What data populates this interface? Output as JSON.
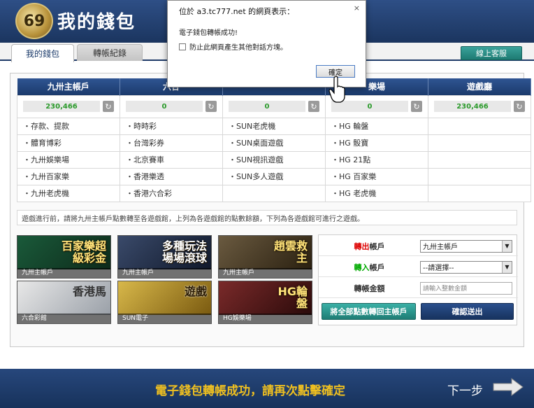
{
  "header": {
    "title": "我的錢包",
    "logo_text": "69"
  },
  "tabs": [
    {
      "label": "我的錢包",
      "active": true
    },
    {
      "label": "轉帳紀錄",
      "active": false
    }
  ],
  "support_button": "線上客服",
  "accounts": {
    "headers": [
      "九卅主帳戶",
      "六合",
      "",
      "樂場",
      "遊戲廳"
    ],
    "balances": [
      "230,466",
      "0",
      "0",
      "0",
      "230,466"
    ],
    "rows": [
      [
        "・存款、提款",
        "・時時彩",
        "・SUN老虎機",
        "・HG 輪盤",
        ""
      ],
      [
        "・體育博彩",
        "・台灣彩券",
        "・SUN桌面遊戲",
        "・HG 骰寶",
        ""
      ],
      [
        "・九卅娛樂場",
        "・北京賽車",
        "・SUN視訊遊戲",
        "・HG 21點",
        ""
      ],
      [
        "・九卅百家樂",
        "・香港樂透",
        "・SUN多人遊戲",
        "・HG 百家樂",
        ""
      ],
      [
        "・九卅老虎機",
        "・香港六合彩",
        "",
        "・HG 老虎機",
        ""
      ]
    ]
  },
  "notice": "遊戲進行前，請將九卅主帳戶點數轉至各遊戲館，上列為各遊戲館的點數餘額，下列為各遊戲館可進行之遊戲。",
  "games": [
    {
      "label": "九卅主帳戶",
      "title": "百家樂超級彩金"
    },
    {
      "label": "九卅主帳戶",
      "title": "多種玩法場場滾球"
    },
    {
      "label": "九卅主帳戶",
      "title": "趙雲救主"
    },
    {
      "label": "六合彩館",
      "title": "香港馬"
    },
    {
      "label": "SUN電子",
      "title": "遊戲"
    },
    {
      "label": "HG娛樂場",
      "title": "HG輪盤"
    }
  ],
  "transfer": {
    "from_label_red": "轉出",
    "from_label_rest": "帳戶",
    "from_value": "九卅主帳戶",
    "to_label_green": "轉入",
    "to_label_rest": "帳戶",
    "to_value": "--請選擇--",
    "amount_label": "轉帳金額",
    "amount_placeholder": "請輸入整數金額",
    "all_to_main_button": "將全部點數轉回主帳戶",
    "confirm_button": "確認送出"
  },
  "footer": {
    "message": "電子錢包轉帳成功，請再次點擊確定",
    "next_label": "下一步"
  },
  "dialog": {
    "title": "位於 a3.tc777.net 的網頁表示：",
    "close": "×",
    "message": "電子錢包轉帳成功!",
    "checkbox_label": "防止此網頁產生其他對話方塊。",
    "ok_button": "確定"
  },
  "colors": {
    "header": "#1b355f",
    "accent_teal": "#1f7d75",
    "balance_green": "#2a9a2a",
    "footer_text": "#f0c020"
  }
}
